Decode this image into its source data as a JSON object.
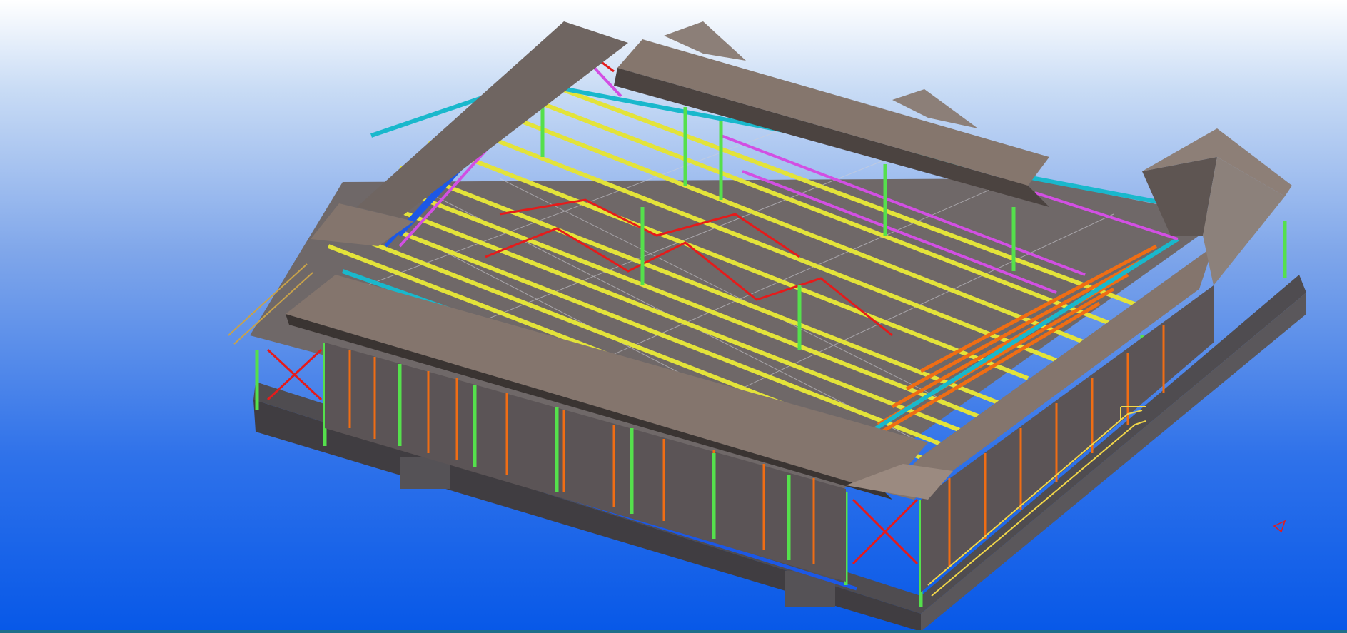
{
  "app": {
    "view": "3D model view"
  },
  "scene": {
    "background_top": "#ffffff",
    "background_bottom": "#0758e8",
    "member_colors": {
      "roof": "#7d6e66",
      "roof_edge": "#3a3432",
      "foundation": "#4f4c50",
      "column": "#55e04c",
      "purlin": "#e3e33a",
      "brace": "#e51b1b",
      "girt": "#ef6d14",
      "edge_beam": "#19b8cc",
      "secondary": "#d24fe3",
      "rail": "#f1d64a"
    }
  }
}
